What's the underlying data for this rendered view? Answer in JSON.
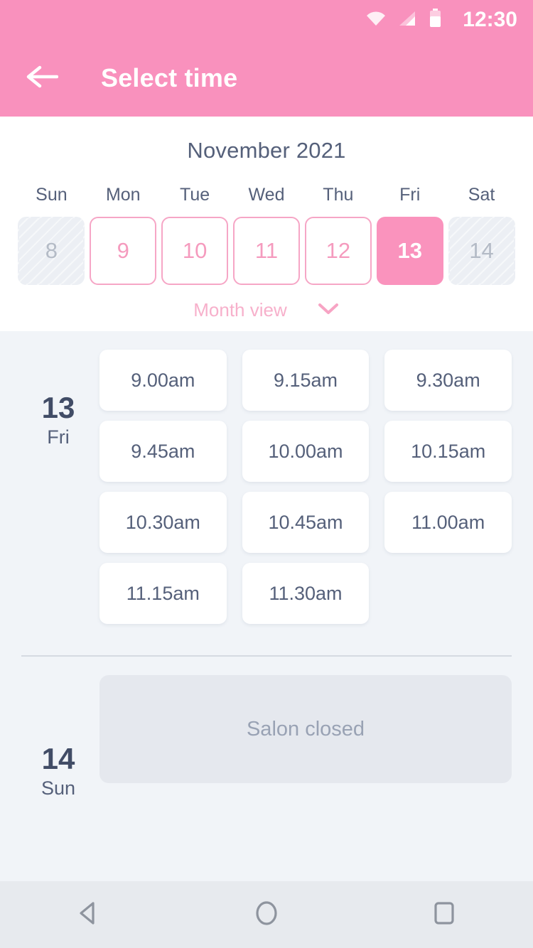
{
  "status_bar": {
    "time": "12:30",
    "icons": [
      "wifi-icon",
      "signal-icon",
      "battery-icon"
    ]
  },
  "app_bar": {
    "back_icon": "back-arrow-icon",
    "title": "Select time"
  },
  "calendar": {
    "month_label": "November 2021",
    "weekdays": [
      "Sun",
      "Mon",
      "Tue",
      "Wed",
      "Thu",
      "Fri",
      "Sat"
    ],
    "days": [
      {
        "num": "8",
        "state": "disabled"
      },
      {
        "num": "9",
        "state": "available"
      },
      {
        "num": "10",
        "state": "available"
      },
      {
        "num": "11",
        "state": "available"
      },
      {
        "num": "12",
        "state": "available"
      },
      {
        "num": "13",
        "state": "selected"
      },
      {
        "num": "14",
        "state": "disabled"
      }
    ],
    "month_view_label": "Month view",
    "month_view_icon": "chevron-down-icon"
  },
  "schedule": [
    {
      "day_num": "13",
      "day_of_week": "Fri",
      "closed": false,
      "closed_text": "",
      "slots": [
        "9.00am",
        "9.15am",
        "9.30am",
        "9.45am",
        "10.00am",
        "10.15am",
        "10.30am",
        "10.45am",
        "11.00am",
        "11.15am",
        "11.30am"
      ]
    },
    {
      "day_num": "14",
      "day_of_week": "Sun",
      "closed": true,
      "closed_text": "Salon closed",
      "slots": []
    }
  ],
  "nav_bar": {
    "back": "nav-back-icon",
    "home": "nav-home-icon",
    "recents": "nav-recents-icon"
  },
  "colors": {
    "brand_pink": "#f991bd",
    "selected_pink": "#fa93bd",
    "outline_pink": "#f6a6c6",
    "text_slate": "#55607a",
    "page_bg": "#f1f4f8",
    "card_white": "#ffffff",
    "closed_grey": "#e5e8ee"
  }
}
